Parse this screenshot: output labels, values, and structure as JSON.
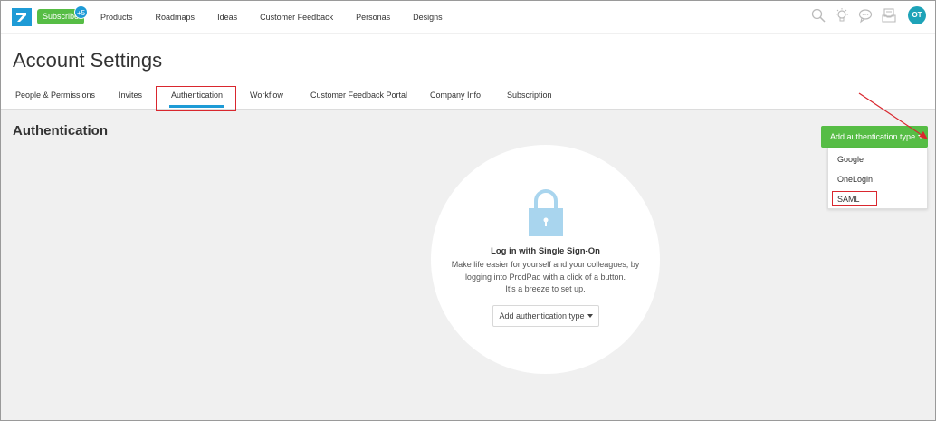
{
  "nav": {
    "subscribe_label": "Subscribe",
    "subscribe_badge": "+5",
    "links": [
      "Products",
      "Roadmaps",
      "Ideas",
      "Customer Feedback",
      "Personas",
      "Designs"
    ],
    "avatar_initials": "OT"
  },
  "header": {
    "title": "Account Settings",
    "tabs": [
      {
        "label": "People & Permissions"
      },
      {
        "label": "Invites"
      },
      {
        "label": "Authentication",
        "active": true
      },
      {
        "label": "Workflow"
      },
      {
        "label": "Customer Feedback Portal"
      },
      {
        "label": "Company Info"
      },
      {
        "label": "Subscription"
      }
    ]
  },
  "main": {
    "section_title": "Authentication",
    "add_button_label": "Add authentication type",
    "dropdown_options": [
      "Google",
      "OneLogin",
      "SAML"
    ],
    "empty_state": {
      "title": "Log in with Single Sign-On",
      "desc_lines": [
        "Make life easier for yourself and your colleagues, by",
        "logging into ProdPad with a click of a button.",
        "It's a breeze to set up."
      ],
      "button_label": "Add authentication type"
    }
  },
  "colors": {
    "brand_green": "#56bd45",
    "accent_blue": "#1e9bd6",
    "highlight_red": "#d9272e",
    "lock_blue": "#a9d5ee"
  }
}
